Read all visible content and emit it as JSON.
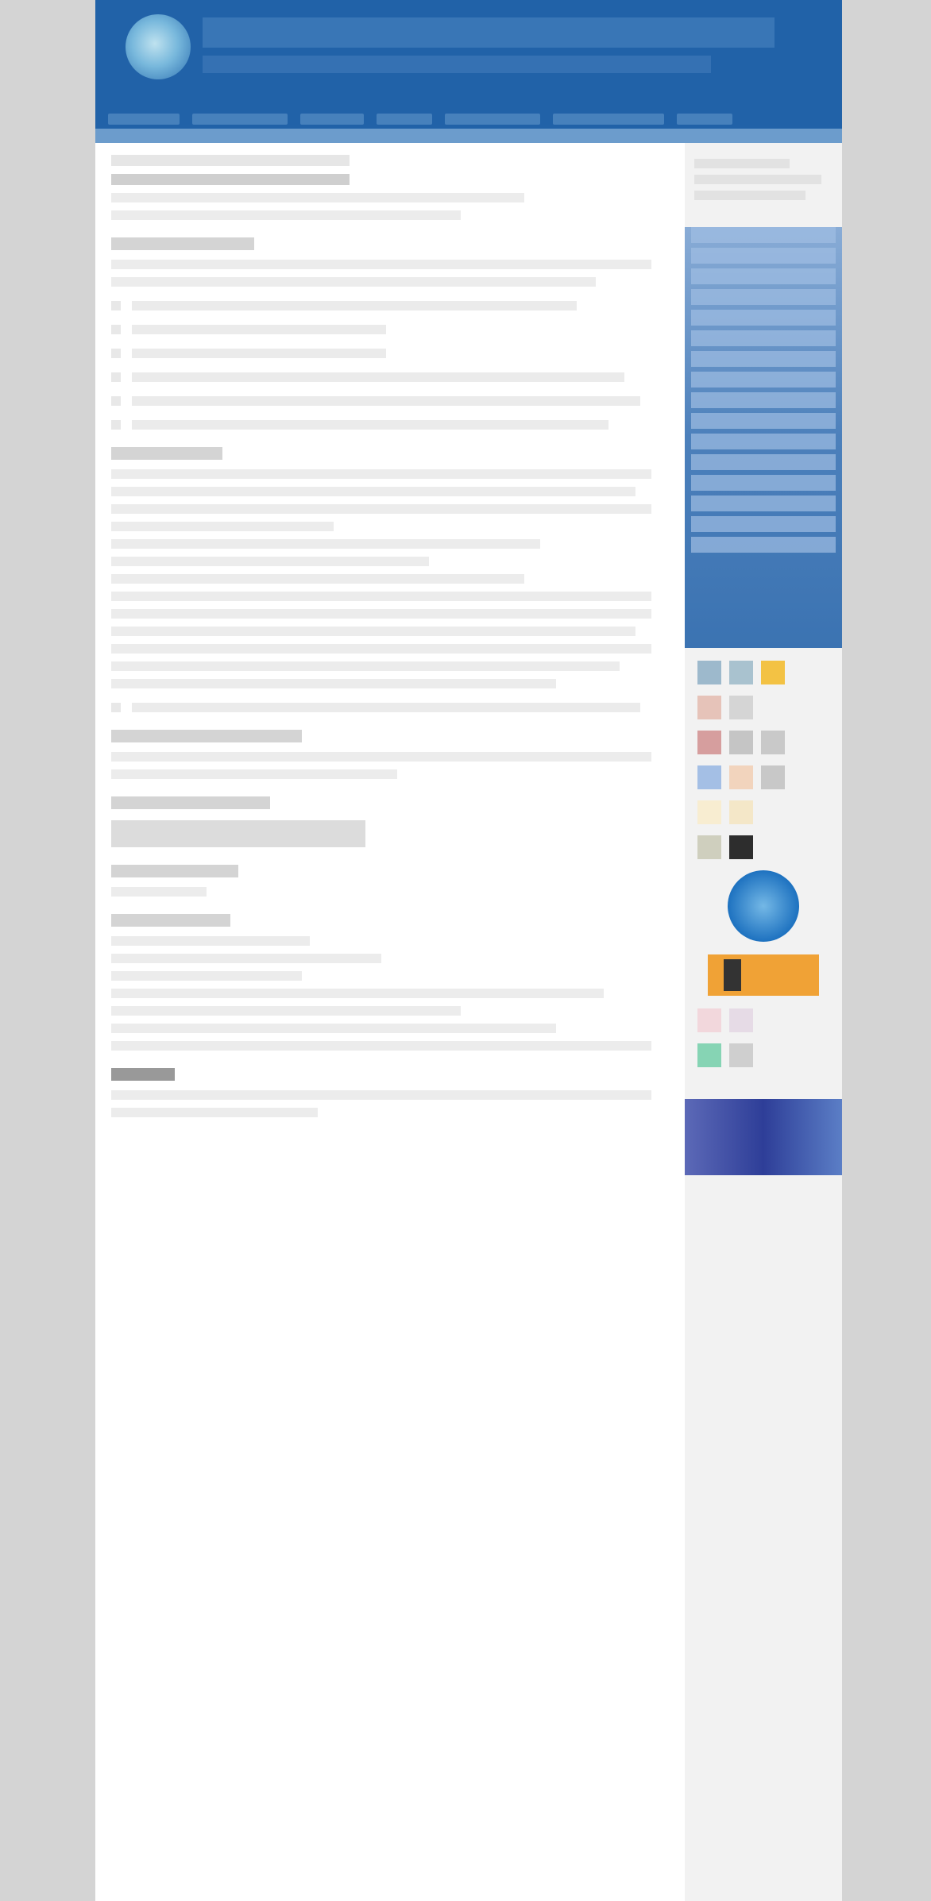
{
  "page": {
    "header": {
      "title": "",
      "subtitle": ""
    },
    "nav": {
      "items": []
    },
    "content": {
      "title_lines": [],
      "sections": []
    },
    "sidebar": {
      "menu_items": []
    }
  },
  "colors": {
    "header_blue": "#2162a8",
    "sidebar_blue_start": "#89acd6",
    "sidebar_blue_end": "#3b73b2",
    "page_bg": "#d4d4d4",
    "content_bg": "#ffffff"
  }
}
